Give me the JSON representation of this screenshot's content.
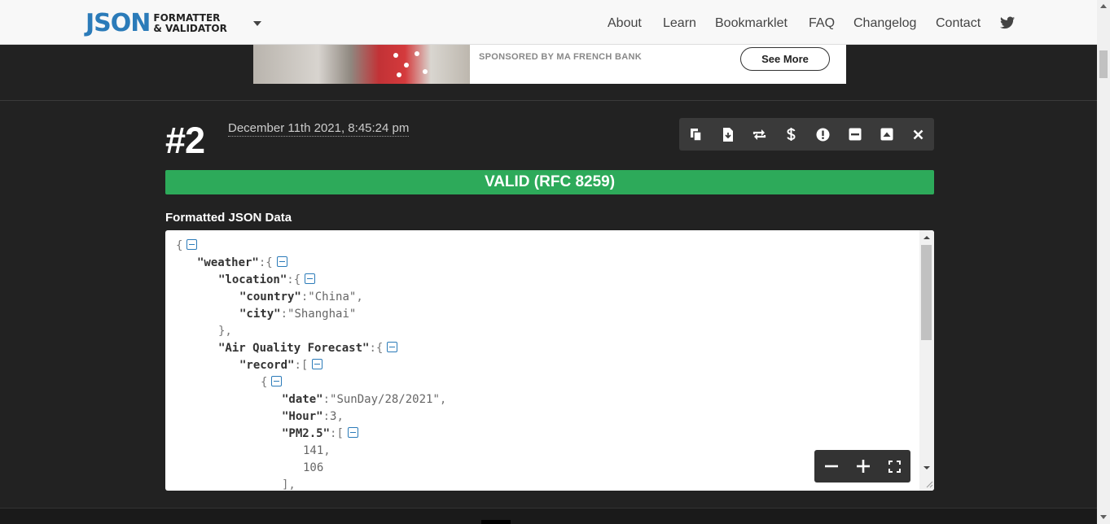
{
  "logo": {
    "main": "JSON",
    "line1": "FORMATTER",
    "line2": "& VALIDATOR"
  },
  "nav": {
    "items": [
      "About",
      "Learn",
      "Bookmarklet",
      "FAQ",
      "Changelog",
      "Contact"
    ]
  },
  "ad": {
    "sponsor": "SPONSORED BY MA FRENCH BANK",
    "cta": "See More"
  },
  "entry": {
    "number": "#2",
    "date": "December 11th 2021, 8:45:24 pm",
    "status": "VALID (RFC 8259)",
    "section_label": "Formatted JSON Data"
  },
  "toolbar": [
    "copy-icon",
    "download-icon",
    "repeat-icon",
    "dollar-icon",
    "alert-icon",
    "minimize-icon",
    "collapse-icon",
    "close-icon"
  ],
  "zoom": [
    "zoom-out-icon",
    "zoom-in-icon",
    "fullscreen-icon"
  ],
  "json_lines": [
    {
      "indent": 0,
      "parts": [
        [
          "punc",
          "{"
        ]
      ],
      "fold": true
    },
    {
      "indent": 1,
      "parts": [
        [
          "key",
          "\"weather\""
        ],
        [
          "punc",
          ":{"
        ]
      ],
      "fold": true
    },
    {
      "indent": 2,
      "parts": [
        [
          "key",
          "\"location\""
        ],
        [
          "punc",
          ":{"
        ]
      ],
      "fold": true
    },
    {
      "indent": 3,
      "parts": [
        [
          "key",
          "\"country\""
        ],
        [
          "punc",
          ":"
        ],
        [
          "str",
          "\"China\""
        ],
        [
          "punc",
          ","
        ]
      ],
      "fold": false
    },
    {
      "indent": 3,
      "parts": [
        [
          "key",
          "\"city\""
        ],
        [
          "punc",
          ":"
        ],
        [
          "str",
          "\"Shanghai\""
        ]
      ],
      "fold": false
    },
    {
      "indent": 2,
      "parts": [
        [
          "punc",
          "},"
        ]
      ],
      "fold": false
    },
    {
      "indent": 2,
      "parts": [
        [
          "key",
          "\"Air Quality Forecast\""
        ],
        [
          "punc",
          ":{"
        ]
      ],
      "fold": true
    },
    {
      "indent": 3,
      "parts": [
        [
          "key",
          "\"record\""
        ],
        [
          "punc",
          ":["
        ]
      ],
      "fold": true
    },
    {
      "indent": 4,
      "parts": [
        [
          "punc",
          "{"
        ]
      ],
      "fold": true
    },
    {
      "indent": 5,
      "parts": [
        [
          "key",
          "\"date\""
        ],
        [
          "punc",
          ":"
        ],
        [
          "str",
          "\"SunDay/28/2021\""
        ],
        [
          "punc",
          ","
        ]
      ],
      "fold": false
    },
    {
      "indent": 5,
      "parts": [
        [
          "key",
          "\"Hour\""
        ],
        [
          "punc",
          ":"
        ],
        [
          "num",
          "3"
        ],
        [
          "punc",
          ","
        ]
      ],
      "fold": false
    },
    {
      "indent": 5,
      "parts": [
        [
          "key",
          "\"PM2.5\""
        ],
        [
          "punc",
          ":["
        ]
      ],
      "fold": true
    },
    {
      "indent": 6,
      "parts": [
        [
          "num",
          "141"
        ],
        [
          "punc",
          ","
        ]
      ],
      "fold": false
    },
    {
      "indent": 6,
      "parts": [
        [
          "num",
          "106"
        ]
      ],
      "fold": false
    },
    {
      "indent": 5,
      "parts": [
        [
          "punc",
          "],"
        ]
      ],
      "fold": false
    }
  ]
}
